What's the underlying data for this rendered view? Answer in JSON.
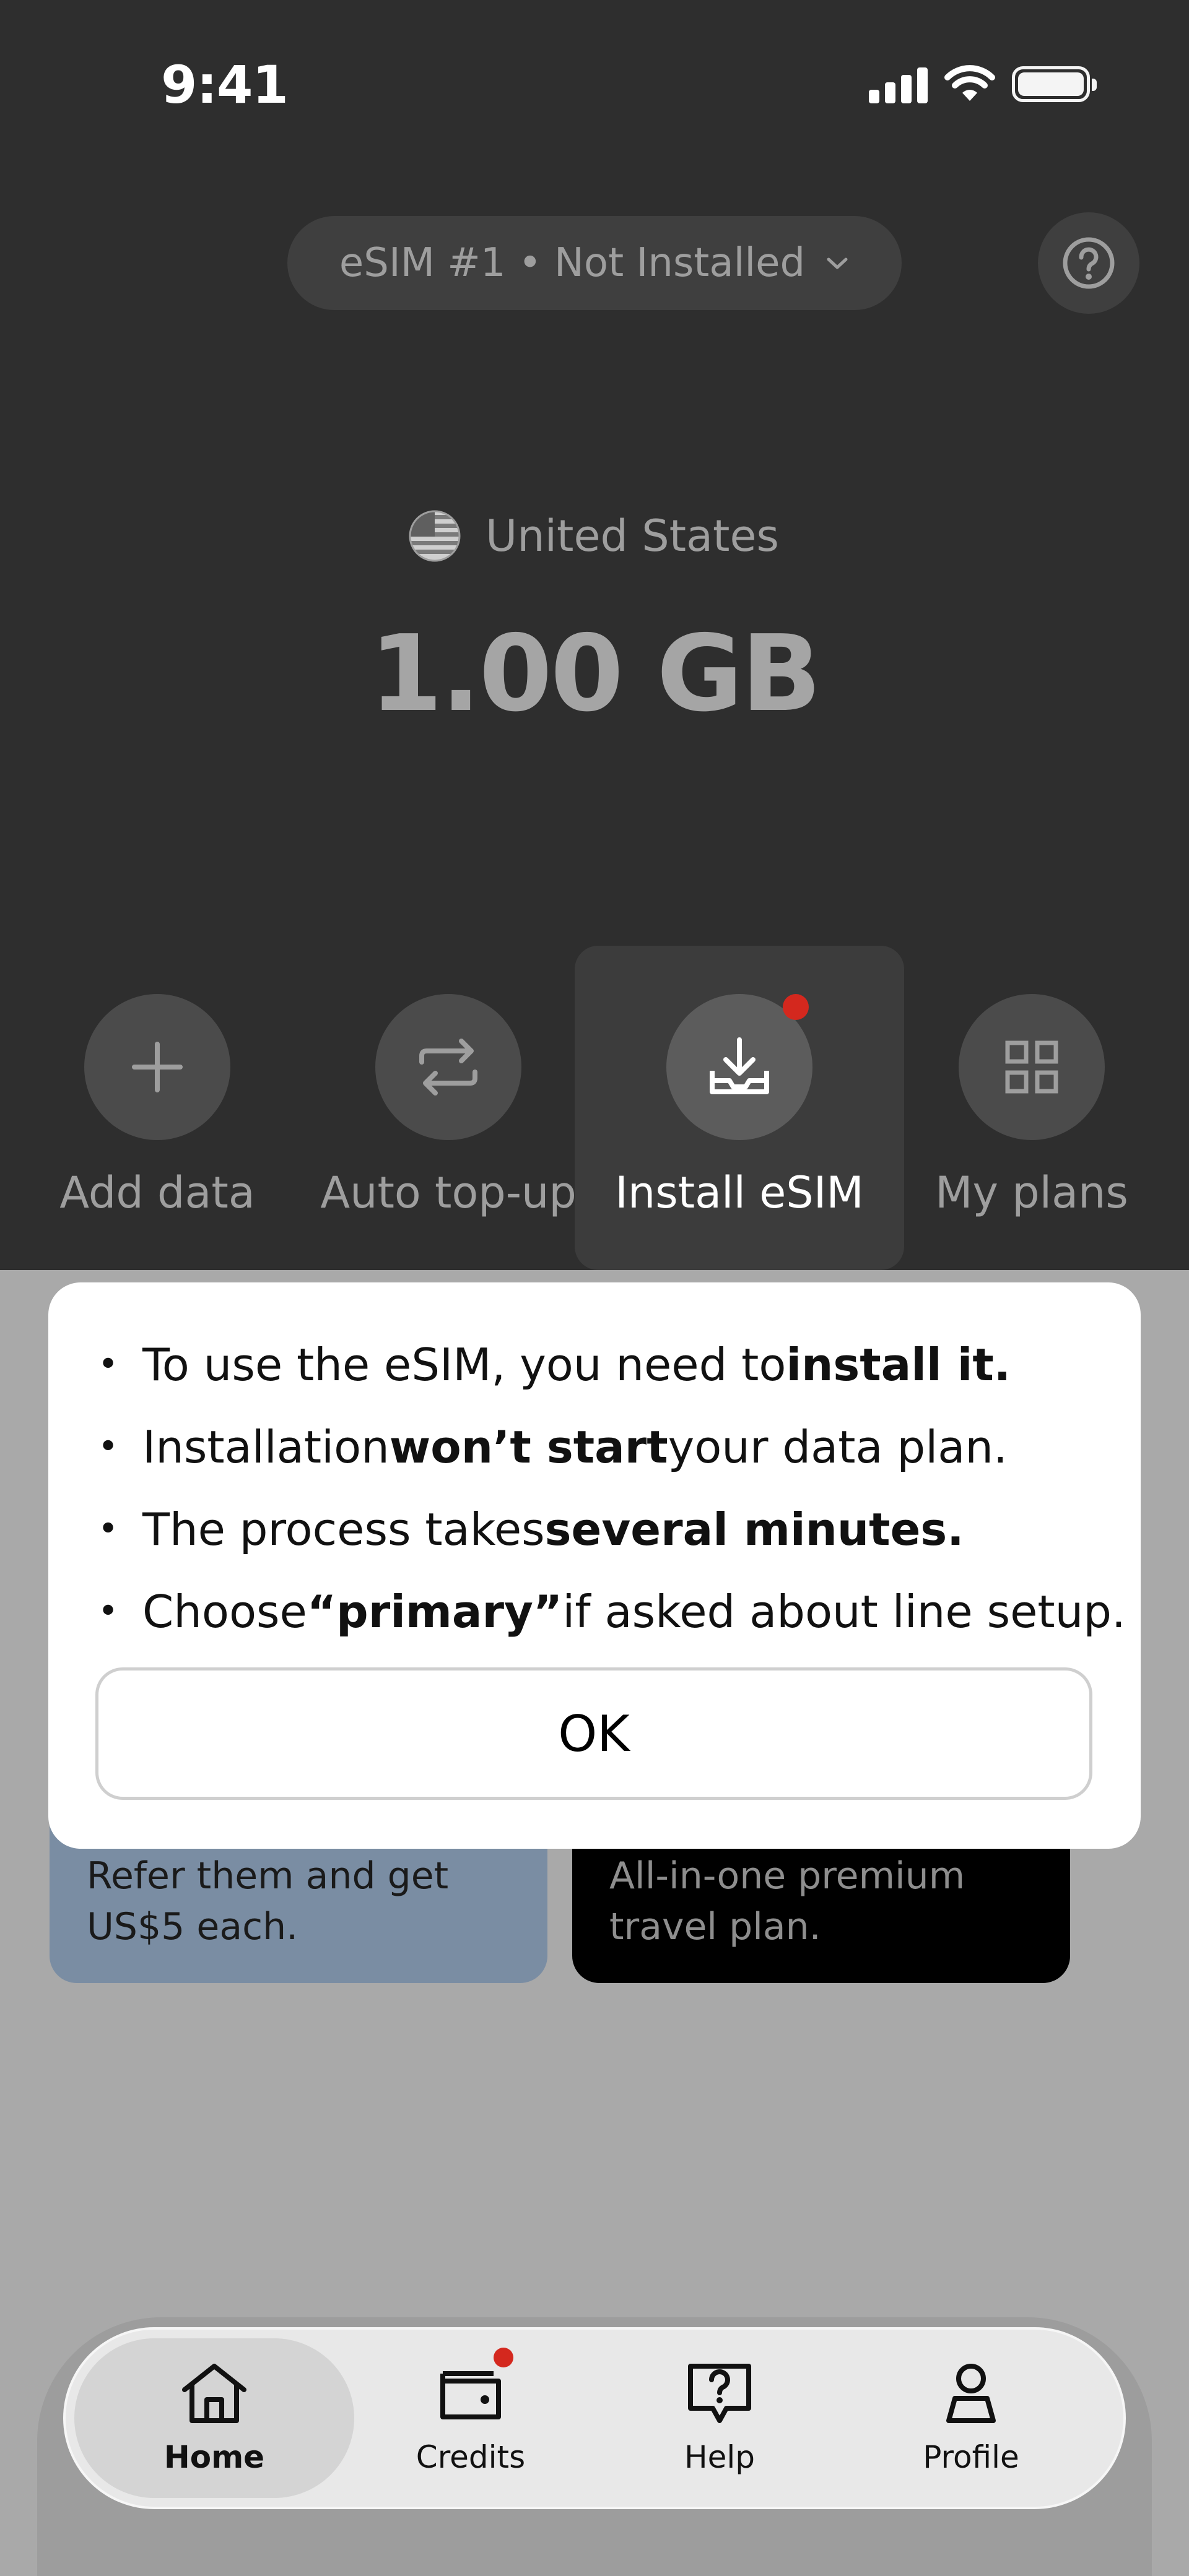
{
  "status_bar": {
    "time": "9:41"
  },
  "header": {
    "esim_selector": "eSIM #1 • Not Installed"
  },
  "plan": {
    "country": "United States",
    "data_amount": "1.00 GB"
  },
  "actions": [
    {
      "label": "Add data",
      "icon": "plus-icon"
    },
    {
      "label": "Auto top-up",
      "icon": "repeat-icon"
    },
    {
      "label": "Install eSIM",
      "icon": "download-icon"
    },
    {
      "label": "My plans",
      "icon": "grid-icon"
    }
  ],
  "cards": {
    "referral": "Refer them and get US$5 each.",
    "premium": "All-in-one premium travel plan."
  },
  "dialog": {
    "items": [
      {
        "pre": "To use the eSIM, you need to ",
        "bold": "install it.",
        "post": ""
      },
      {
        "pre": "Installation ",
        "bold": "won’t start",
        "post": " your data plan."
      },
      {
        "pre": "The process takes ",
        "bold": "several minutes.",
        "post": ""
      },
      {
        "pre": "Choose ",
        "bold": "“primary”",
        "post": " if asked about line setup."
      }
    ],
    "ok_label": "OK"
  },
  "tabbar": {
    "tabs": [
      {
        "label": "Home",
        "icon": "home-icon",
        "active": true
      },
      {
        "label": "Credits",
        "icon": "wallet-icon",
        "active": false
      },
      {
        "label": "Help",
        "icon": "help-icon",
        "active": false
      },
      {
        "label": "Profile",
        "icon": "profile-icon",
        "active": false
      }
    ]
  },
  "colors": {
    "notification_dot": "#d4281e",
    "overlay": "#a9a9a9",
    "header_bg": "#2e2e2e"
  }
}
